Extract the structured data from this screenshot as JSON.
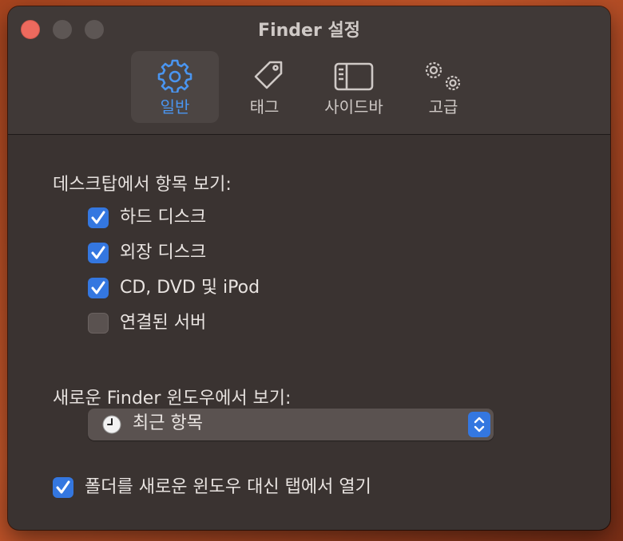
{
  "window": {
    "title": "Finder 설정"
  },
  "tabs": [
    {
      "label": "일반",
      "icon": "gear-icon",
      "active": true
    },
    {
      "label": "태그",
      "icon": "tag-icon",
      "active": false
    },
    {
      "label": "사이드바",
      "icon": "sidebar-icon",
      "active": false
    },
    {
      "label": "고급",
      "icon": "gears-icon",
      "active": false
    }
  ],
  "desktop_section": {
    "heading": "데스크탑에서 항목 보기:",
    "items": [
      {
        "label": "하드 디스크",
        "checked": true
      },
      {
        "label": "외장 디스크",
        "checked": true
      },
      {
        "label": "CD, DVD 및 iPod",
        "checked": true
      },
      {
        "label": "연결된 서버",
        "checked": false
      }
    ]
  },
  "new_window_section": {
    "heading": "새로운 Finder 윈도우에서 보기:",
    "selected": "최근 항목",
    "icon": "clock-icon"
  },
  "folder_option": {
    "label": "폴더를 새로운 윈도우 대신 탭에서 열기",
    "checked": true
  },
  "colors": {
    "accent": "#3477e0",
    "active_tab_text": "#4a95f0",
    "window_bg": "#3a3331"
  }
}
